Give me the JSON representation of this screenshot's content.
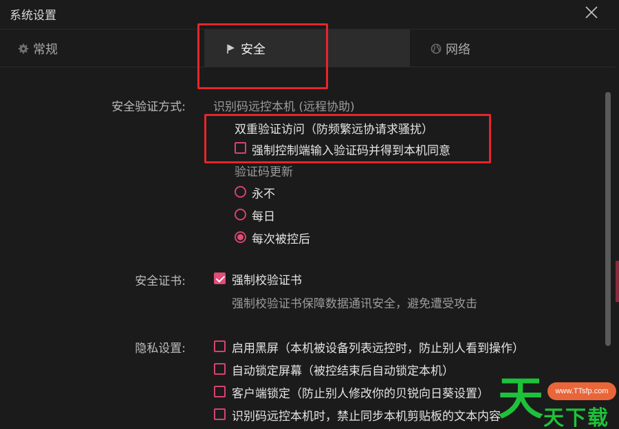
{
  "window": {
    "title": "系统设置"
  },
  "tabs": [
    {
      "label": "常规",
      "icon": "gear-icon"
    },
    {
      "label": "安全",
      "icon": "flag-icon"
    },
    {
      "label": "网络",
      "icon": "globe-icon"
    }
  ],
  "active_tab": "安全",
  "security_verify": {
    "label": "安全验证方式:",
    "method": "识别码远控本机 (远程协助)",
    "double_verify_label": "双重验证访问（防频繁远协请求骚扰）",
    "force_code_option": {
      "label": "强制控制端输入验证码并得到本机同意",
      "checked": false
    },
    "code_update_label": "验证码更新",
    "code_update_options": [
      {
        "label": "永不",
        "checked": false
      },
      {
        "label": "每日",
        "checked": false
      },
      {
        "label": "每次被控后",
        "checked": true
      }
    ]
  },
  "certificate": {
    "label": "安全证书:",
    "option": {
      "label": "强制校验证书",
      "checked": true
    },
    "description": "强制校验证书保障数据通讯安全，避免遭受攻击"
  },
  "privacy": {
    "label": "隐私设置:",
    "options": [
      {
        "label": "启用黑屏（本机被设备列表远控时，防止别人看到操作）",
        "checked": false
      },
      {
        "label": "自动锁定屏幕（被控结束后自动锁定本机）",
        "checked": false
      },
      {
        "label": "客户端锁定（防止别人修改你的贝锐向日葵设置）",
        "checked": false
      },
      {
        "label": "识别码远控本机时，禁止同步本机剪贴板的文本内容",
        "checked": false
      }
    ]
  },
  "watermark": {
    "url": "www.TTsfp.com",
    "brand": "天下载",
    "glyph": "天"
  },
  "colors": {
    "accent": "#e04d76",
    "highlight": "#e8262a",
    "background": "#1b1b1c"
  }
}
